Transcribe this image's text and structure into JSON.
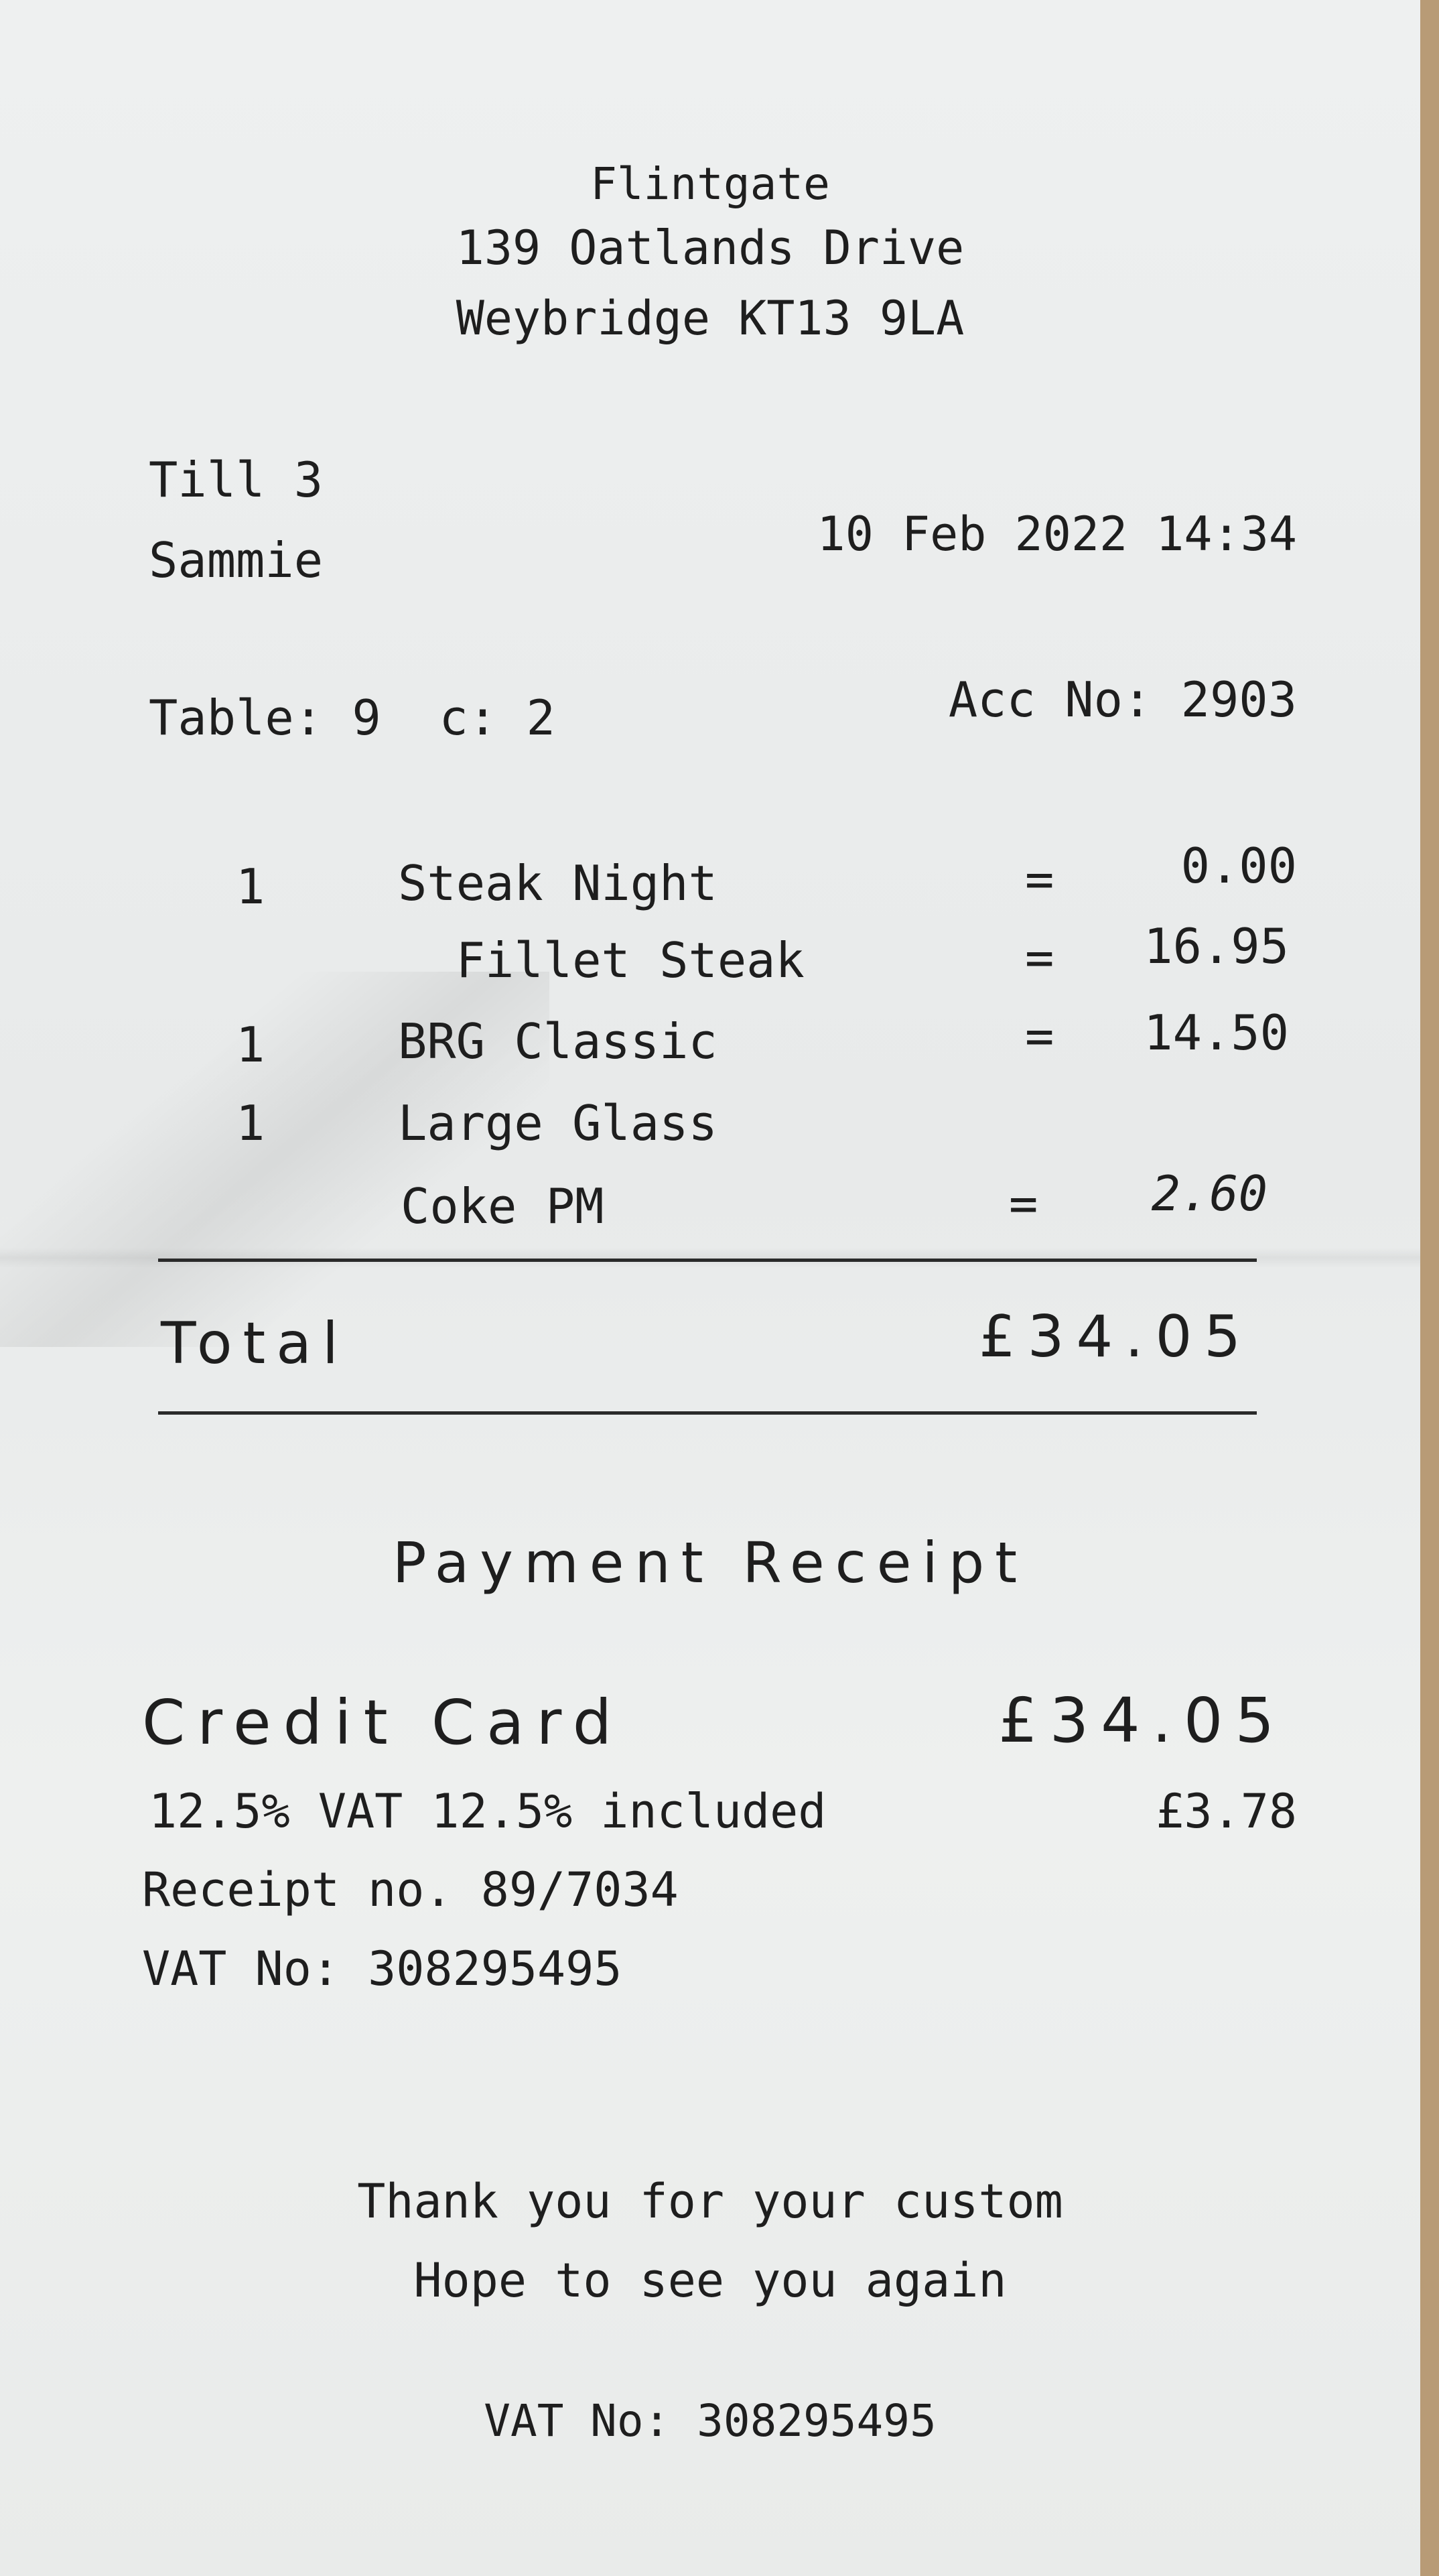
{
  "header": {
    "name": "Flintgate",
    "address1": "139 Oatlands Drive",
    "address2": "Weybridge KT13 9LA"
  },
  "meta": {
    "till": "Till 3",
    "server": "Sammie",
    "datetime": "10 Feb 2022 14:34",
    "table": "Table: 9  c: 2",
    "account": "Acc No: 2903"
  },
  "items": [
    {
      "qty": "1",
      "name": "Steak Night",
      "eq": "=",
      "price": "0.00"
    },
    {
      "qty": "",
      "name": "  Fillet Steak",
      "eq": "=",
      "price": "16.95"
    },
    {
      "qty": "1",
      "name": "BRG Classic",
      "eq": "=",
      "price": "14.50"
    },
    {
      "qty": "1",
      "name": "Large Glass",
      "eq": "",
      "price": ""
    },
    {
      "qty": "",
      "name": "Coke PM",
      "eq": "=",
      "price": "2.60"
    }
  ],
  "total": {
    "label": "Total",
    "amount": "£34.05"
  },
  "payment": {
    "heading": "Payment Receipt",
    "method": "Credit Card",
    "amount": "£34.05",
    "vat_line": "12.5% VAT 12.5% included",
    "vat_amount": "£3.78",
    "receipt_no": "Receipt no. 89/7034",
    "vat_no": "VAT No: 308295495"
  },
  "footer": {
    "thanks": "Thank you for your custom",
    "hope": "Hope to see you again",
    "vat_no": "VAT No: 308295495"
  }
}
